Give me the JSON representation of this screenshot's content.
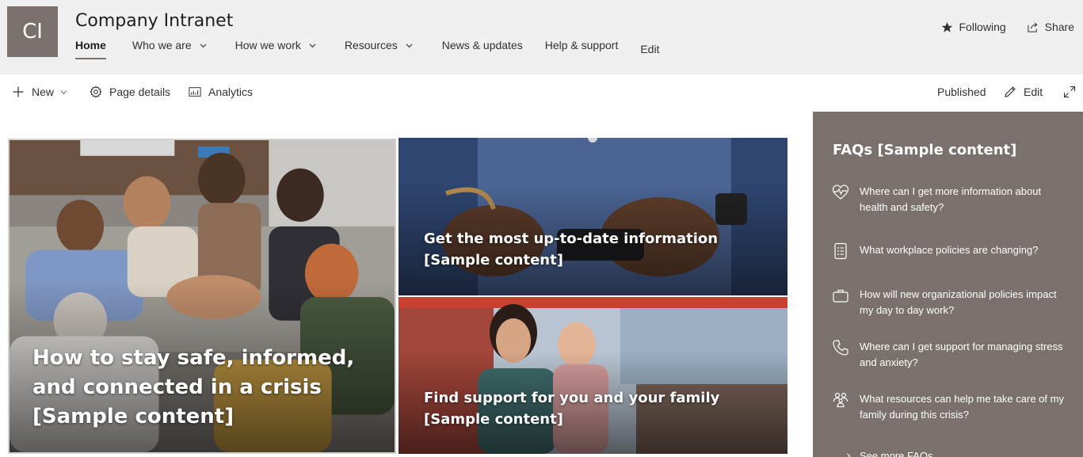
{
  "site": {
    "logo_initials": "CI",
    "title": "Company Intranet",
    "nav": [
      {
        "label": "Home",
        "active": true
      },
      {
        "label": "Who we are",
        "has_dropdown": true
      },
      {
        "label": "How we work",
        "has_dropdown": true
      },
      {
        "label": "Resources",
        "has_dropdown": true
      },
      {
        "label": "News & updates"
      },
      {
        "label": "Help & support"
      },
      {
        "label": "Edit"
      }
    ],
    "actions": {
      "following": "Following",
      "share": "Share"
    }
  },
  "command_bar": {
    "new": "New",
    "page_details": "Page details",
    "analytics": "Analytics",
    "status": "Published",
    "edit": "Edit"
  },
  "hero": {
    "main": {
      "title": "How to stay safe, informed, and connected in a crisis [Sample content]"
    },
    "top": {
      "title": "Get the most up-to-date information [Sample content]"
    },
    "bottom": {
      "title": "Find support for you and your family [Sample content]"
    }
  },
  "faq": {
    "title": "FAQs [Sample content]",
    "items": [
      {
        "icon": "heart-pulse-icon",
        "text": "Where can I get more information about health and safety?"
      },
      {
        "icon": "checklist-icon",
        "text": "What workplace policies are changing?"
      },
      {
        "icon": "briefcase-icon",
        "text": "How will new organizational policies impact my day to day work?"
      },
      {
        "icon": "phone-icon",
        "text": "Where can I get support for managing stress and anxiety?"
      },
      {
        "icon": "family-icon",
        "text": "What resources can help me take care of my family during this crisis?"
      }
    ],
    "see_more": "See more FAQs"
  },
  "colors": {
    "theme": "#7a716e",
    "header_bg": "#f0f0f0"
  }
}
